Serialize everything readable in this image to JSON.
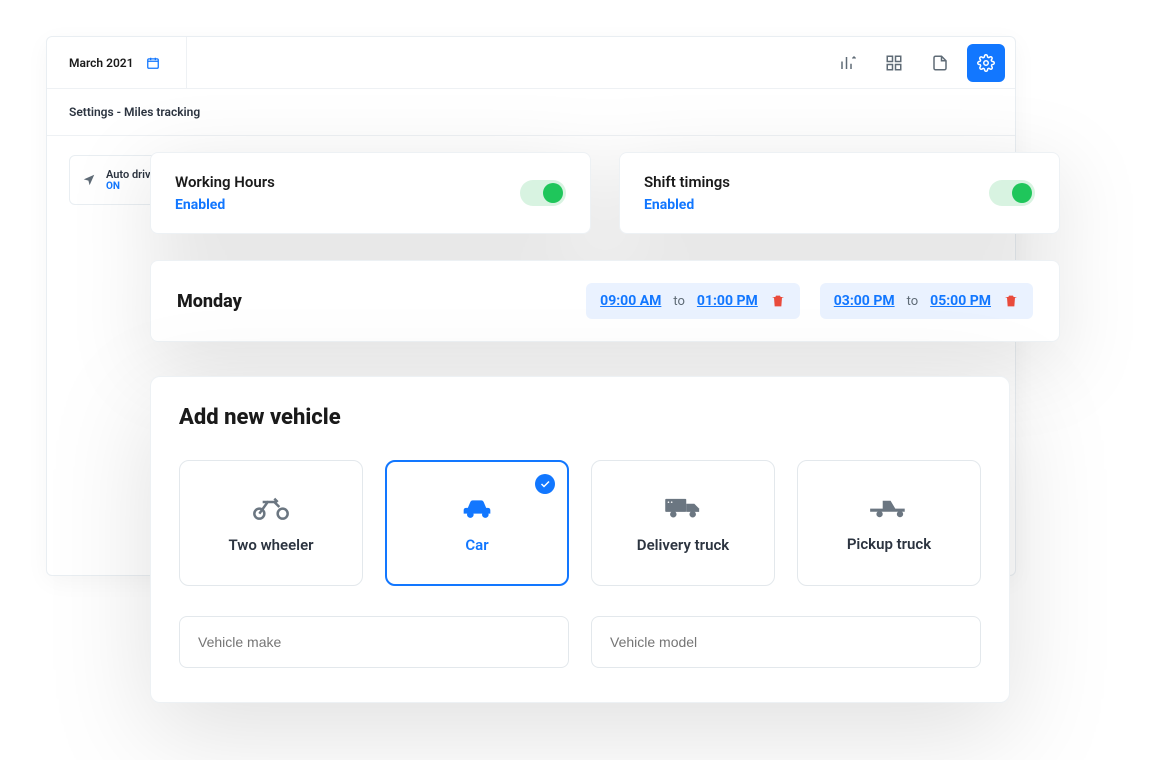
{
  "header": {
    "date_label": "March 2021",
    "icons": [
      "chart-icon",
      "grid-icon",
      "export-icon",
      "gear-icon"
    ]
  },
  "settings_title": "Settings - Miles tracking",
  "auto_drive": {
    "label": "Auto drive",
    "state": "ON"
  },
  "working_hours": {
    "title": "Working Hours",
    "status": "Enabled",
    "enabled": true
  },
  "shift_timings": {
    "title": "Shift timings",
    "status": "Enabled",
    "enabled": true
  },
  "schedule": {
    "day": "Monday",
    "slots": [
      {
        "from": "09:00 AM",
        "to_label": "to",
        "to": "01:00 PM"
      },
      {
        "from": "03:00 PM",
        "to_label": "to",
        "to": "05:00 PM"
      }
    ]
  },
  "add_vehicle": {
    "heading": "Add new vehicle",
    "options": [
      {
        "label": "Two wheeler",
        "selected": false
      },
      {
        "label": "Car",
        "selected": true
      },
      {
        "label": "Delivery truck",
        "selected": false
      },
      {
        "label": "Pickup truck",
        "selected": false
      }
    ],
    "make_placeholder": "Vehicle make",
    "model_placeholder": "Vehicle model"
  }
}
